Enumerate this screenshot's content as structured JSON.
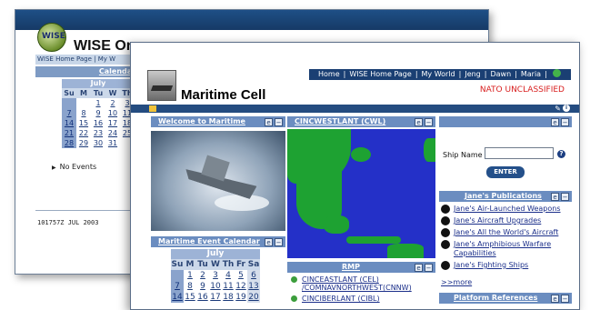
{
  "back_window": {
    "logo_text": "WISE",
    "title": "WISE Or",
    "nav": "WISE Home Page | My W",
    "calendar_label": "Calendar",
    "calendar": {
      "month": "July",
      "dow": [
        "Su",
        "M",
        "Tu",
        "W",
        "Th"
      ],
      "rows": [
        [
          "",
          "",
          "1",
          "2",
          "3",
          "4"
        ],
        [
          "7",
          "8",
          "9",
          "10",
          "11"
        ],
        [
          "14",
          "15",
          "16",
          "17",
          "18"
        ],
        [
          "21",
          "22",
          "23",
          "24",
          "25"
        ],
        [
          "28",
          "29",
          "30",
          "31",
          ""
        ]
      ]
    },
    "events": "No Events",
    "datetime": "101757Z JUL 2003"
  },
  "front_window": {
    "title": "Maritime Cell",
    "nav": {
      "items": [
        "Home",
        "WISE Home Page",
        "My World",
        "Jeng",
        "Dawn",
        "Maria"
      ]
    },
    "classification": "NATO UNCLASSIFIED",
    "classification_color": "#d81e1e",
    "welcome": {
      "header": "Welcome to Maritime"
    },
    "event_calendar": {
      "header": "Maritime Event Calendar",
      "month": "July",
      "dow": [
        "Su",
        "M",
        "Tu",
        "W",
        "Th",
        "Fr",
        "Sa"
      ],
      "rows": [
        [
          "",
          "1",
          "2",
          "3",
          "4",
          "5",
          "6"
        ],
        [
          "7",
          "8",
          "9",
          "10",
          "11",
          "12",
          "13"
        ],
        [
          "14",
          "15",
          "16",
          "17",
          "18",
          "19",
          "20"
        ]
      ]
    },
    "map_panel": {
      "header": "CINCWESTLANT (CWL)"
    },
    "rmp": {
      "header": "RMP",
      "items": [
        "CINCEASTLANT (CEL) /COMNAVNORTHWEST(CNNW)",
        "CINCIBERLANT (CIBL)"
      ]
    },
    "ship_search": {
      "label": "Ship Name",
      "input_value": "",
      "button": "ENTER"
    },
    "publications": {
      "header": "Jane's Publications",
      "items": [
        "Jane's Air-Launched Weapons",
        "Jane's Aircraft Upgrades",
        "Jane's All the World's Aircraft",
        "Jane's Amphibious Warfare Capabilities",
        "Jane's Fighting Ships"
      ],
      "more": ">>more"
    },
    "platform": {
      "header": "Platform References"
    }
  }
}
